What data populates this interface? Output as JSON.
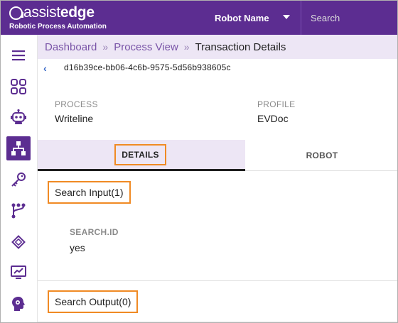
{
  "header": {
    "logo_light": "assist",
    "logo_bold": "edge",
    "logo_subtitle": "Robotic Process Automation",
    "robot_select_label": "Robot Name",
    "search_placeholder": "Search"
  },
  "sidebar": {
    "items": [
      {
        "name": "menu",
        "icon": "hamburger-icon"
      },
      {
        "name": "dashboard",
        "icon": "grid-icon"
      },
      {
        "name": "robots",
        "icon": "robot-icon"
      },
      {
        "name": "process-view",
        "icon": "hierarchy-icon",
        "active": true
      },
      {
        "name": "keys",
        "icon": "key-icon"
      },
      {
        "name": "workflow",
        "icon": "branch-icon"
      },
      {
        "name": "chip",
        "icon": "chip-icon"
      },
      {
        "name": "analytics",
        "icon": "monitor-chart-icon"
      },
      {
        "name": "settings",
        "icon": "head-gear-icon"
      }
    ],
    "accent_color": "#5c2d91"
  },
  "breadcrumb": {
    "items": [
      "Dashboard",
      "Process View"
    ],
    "current": "Transaction Details",
    "separator": "»"
  },
  "transaction": {
    "id": "d16b39ce-bb06-4c6b-9575-5d56b938605c"
  },
  "meta": {
    "process_label": "PROCESS",
    "process_value": "Writeline",
    "profile_label": "PROFILE",
    "profile_value": "EVDoc"
  },
  "tabs": [
    {
      "label": "DETAILS",
      "active": true
    },
    {
      "label": "ROBOT",
      "active": false
    }
  ],
  "search_input": {
    "title": "Search Input(1)",
    "fields": [
      {
        "label": "SEARCH.ID",
        "value": "yes"
      }
    ]
  },
  "search_output": {
    "title": "Search Output(0)"
  },
  "colors": {
    "brand": "#5c2d91",
    "highlight": "#f08a24",
    "tint": "#ede6f5"
  }
}
